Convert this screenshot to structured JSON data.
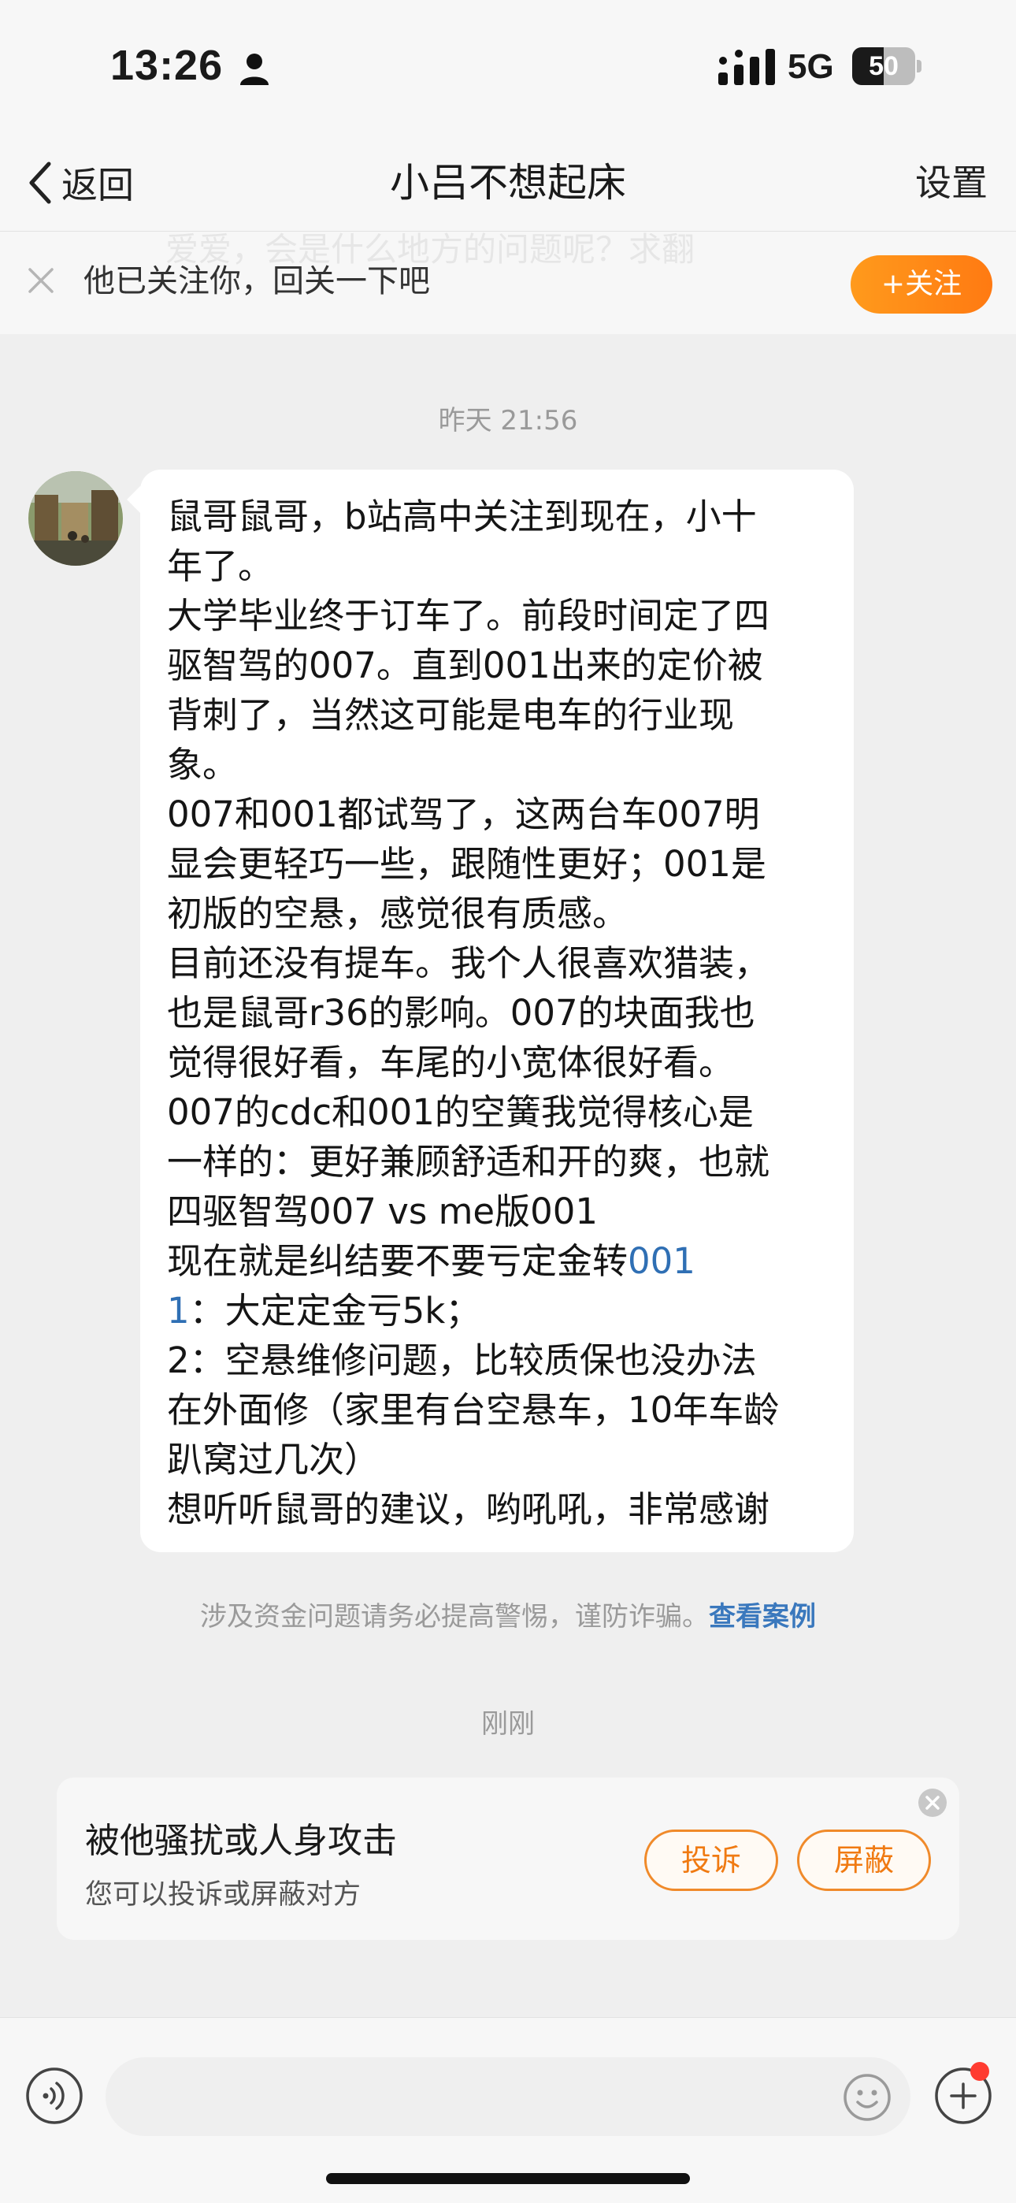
{
  "status_bar": {
    "time": "13:26",
    "network": "5G",
    "battery": "50",
    "battery_level": 0.5
  },
  "nav": {
    "back_label": "返回",
    "title": "小吕不想起床",
    "settings_label": "设置"
  },
  "follow_banner": {
    "text": "他已关注你，回关一下吧",
    "button_label": "+关注",
    "ghost_text": "爱爱，会是什么地方的问题呢？求翻"
  },
  "chat": {
    "timestamp_1": "昨天 21:56",
    "message_lines": [
      "鼠哥鼠哥，b站高中关注到现在，小十",
      "年了。",
      "大学毕业终于订车了。前段时间定了四",
      "驱智驾的007。直到001出来的定价被",
      "背刺了，当然这可能是电车的行业现",
      "象。",
      "007和001都试驾了，这两台车007明",
      "显会更轻巧一些，跟随性更好；001是",
      "初版的空悬，感觉很有质感。",
      "目前还没有提车。我个人很喜欢猎装，",
      "也是鼠哥r36的影响。007的块面我也",
      "觉得很好看，车尾的小宽体很好看。",
      "007的cdc和001的空簧我觉得核心是",
      "一样的：更好兼顾舒适和开的爽，也就",
      "四驱智驾007 vs me版001"
    ],
    "line_16_prefix": "现在就是纠结要不要亏定金转",
    "line_16_link": "001",
    "line_17_link": "1",
    "line_17_rest": "：大定定金亏5k；",
    "message_lines_tail": [
      "2：空悬维修问题，比较质保也没办法",
      "在外面修（家里有台空悬车，10年车龄",
      "趴窝过几次）",
      "想听听鼠哥的建议，哟吼吼，非常感谢"
    ],
    "safety_notice": "涉及资金问题请务必提高警惕，谨防诈骗。",
    "safety_link": "查看案例",
    "timestamp_2": "刚刚"
  },
  "report_card": {
    "title": "被他骚扰或人身攻击",
    "subtitle": "您可以投诉或屏蔽对方",
    "report_label": "投诉",
    "block_label": "屏蔽"
  },
  "input_bar": {
    "placeholder": ""
  },
  "icons": {
    "back": "chevron-left-icon",
    "person": "person-icon",
    "signal": "signal-icon",
    "dismiss": "close-icon",
    "voice": "voice-icon",
    "emoji": "emoji-icon",
    "add": "plus-icon"
  },
  "colors": {
    "accent_orange": "#ff8a1a",
    "link_blue": "#3a78bd",
    "badge_red": "#ff3b30"
  }
}
